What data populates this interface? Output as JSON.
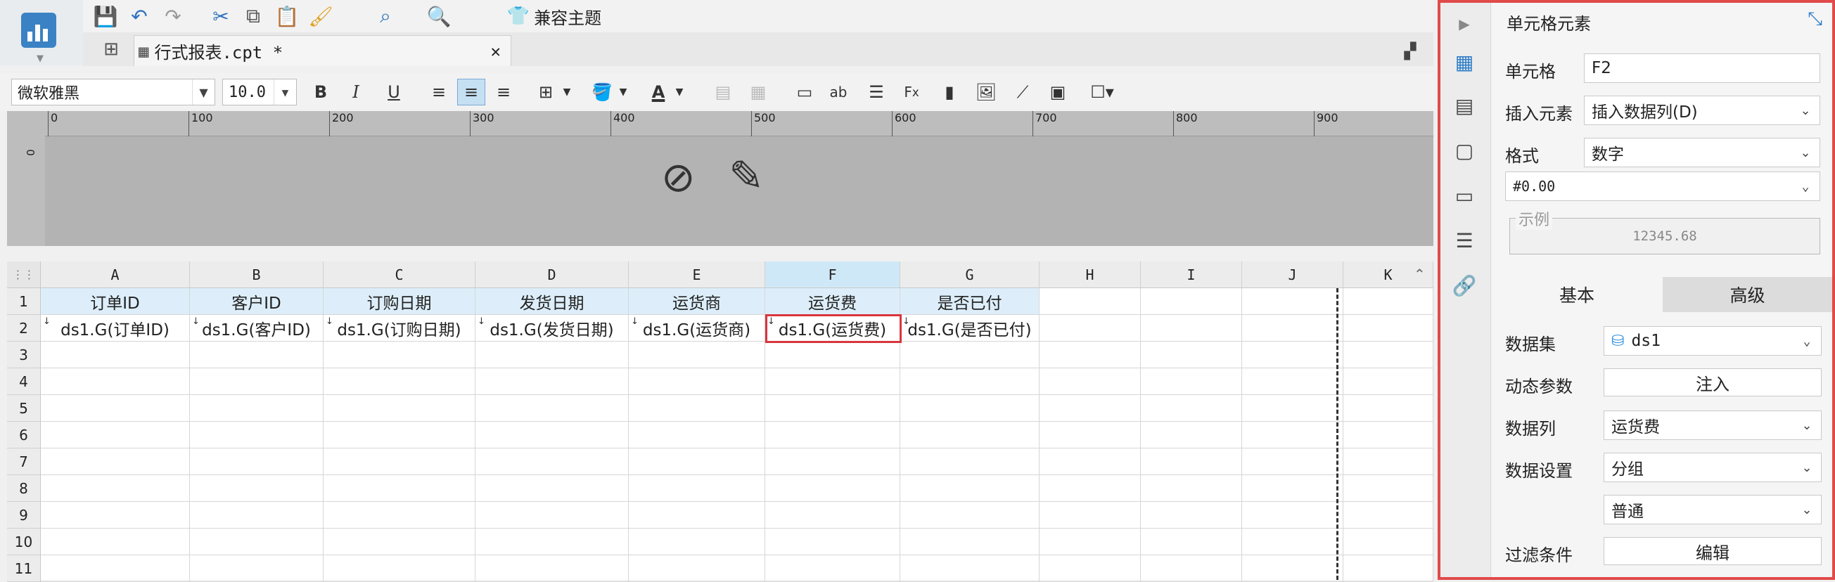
{
  "toolbar": {
    "theme_label": "兼容主题",
    "font_family": "微软雅黑",
    "font_size": "10.0"
  },
  "tab": {
    "title": "行式报表.cpt *"
  },
  "ruler": {
    "marks": [
      "0",
      "100",
      "200",
      "300",
      "400",
      "500",
      "600",
      "700",
      "800",
      "900"
    ],
    "vmark": "0"
  },
  "grid": {
    "columns": [
      "A",
      "B",
      "C",
      "D",
      "E",
      "F",
      "G",
      "H",
      "I",
      "J",
      "K"
    ],
    "rows": [
      "1",
      "2",
      "3",
      "4",
      "5",
      "6",
      "7",
      "8",
      "9",
      "10",
      "11"
    ],
    "header_row": [
      "订单ID",
      "客户ID",
      "订购日期",
      "发货日期",
      "运货商",
      "运货费",
      "是否已付"
    ],
    "data_row": [
      "ds1.G(订单ID)",
      "ds1.G(客户ID)",
      "ds1.G(订购日期)",
      "ds1.G(发货日期)",
      "ds1.G(运货商)",
      "ds1.G(运货费)",
      "ds1.G(是否已付)"
    ],
    "selected_cell": "F2"
  },
  "panel": {
    "title": "单元格元素",
    "cell_label": "单元格",
    "cell_value": "F2",
    "insert_label": "插入元素",
    "insert_value": "插入数据列(D)",
    "format_label": "格式",
    "format_value": "数字",
    "pattern_value": "#0.00",
    "sample_legend": "示例",
    "sample_value": "12345.68",
    "tab_basic": "基本",
    "tab_advanced": "高级",
    "dataset_label": "数据集",
    "dataset_value": "ds1",
    "dynparam_label": "动态参数",
    "dynparam_button": "注入",
    "column_label": "数据列",
    "column_value": "运货费",
    "setting_label": "数据设置",
    "setting_value": "分组",
    "setting_value2": "普通",
    "filter_label": "过滤条件",
    "filter_button": "编辑"
  }
}
